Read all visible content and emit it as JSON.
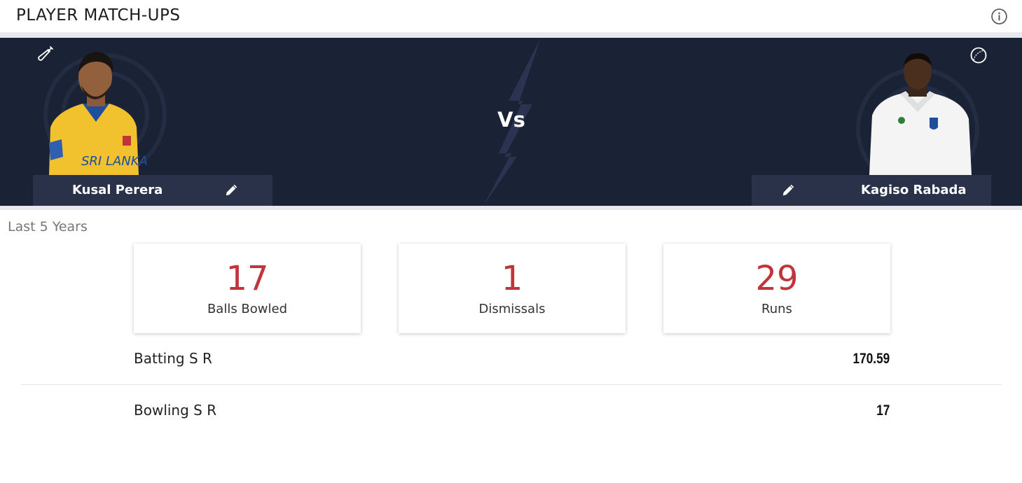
{
  "header": {
    "title": "PLAYER MATCH-UPS",
    "info_icon": "info-circle-icon"
  },
  "matchup": {
    "vs_label": "Vs",
    "batter": {
      "name": "Kusal Perera",
      "role_icon": "cricket-bat-icon",
      "edit_icon": "pencil-icon",
      "jersey_text": "SRI LANKA",
      "jersey_color": "#f2c12e"
    },
    "bowler": {
      "name": "Kagiso Rabada",
      "role_icon": "cricket-ball-icon",
      "edit_icon": "pencil-icon",
      "jersey_color": "#f4f4f4"
    }
  },
  "period": "Last 5 Years",
  "stats": [
    {
      "value": "17",
      "label": "Balls Bowled"
    },
    {
      "value": "1",
      "label": "Dismissals"
    },
    {
      "value": "29",
      "label": "Runs"
    }
  ],
  "rows": [
    {
      "label": "Batting S R",
      "value": "170.59"
    },
    {
      "label": "Bowling S R",
      "value": "17"
    }
  ],
  "colors": {
    "banner_bg": "#1a2236",
    "name_box_bg": "#2a3249",
    "stat_accent": "#c0353a"
  }
}
